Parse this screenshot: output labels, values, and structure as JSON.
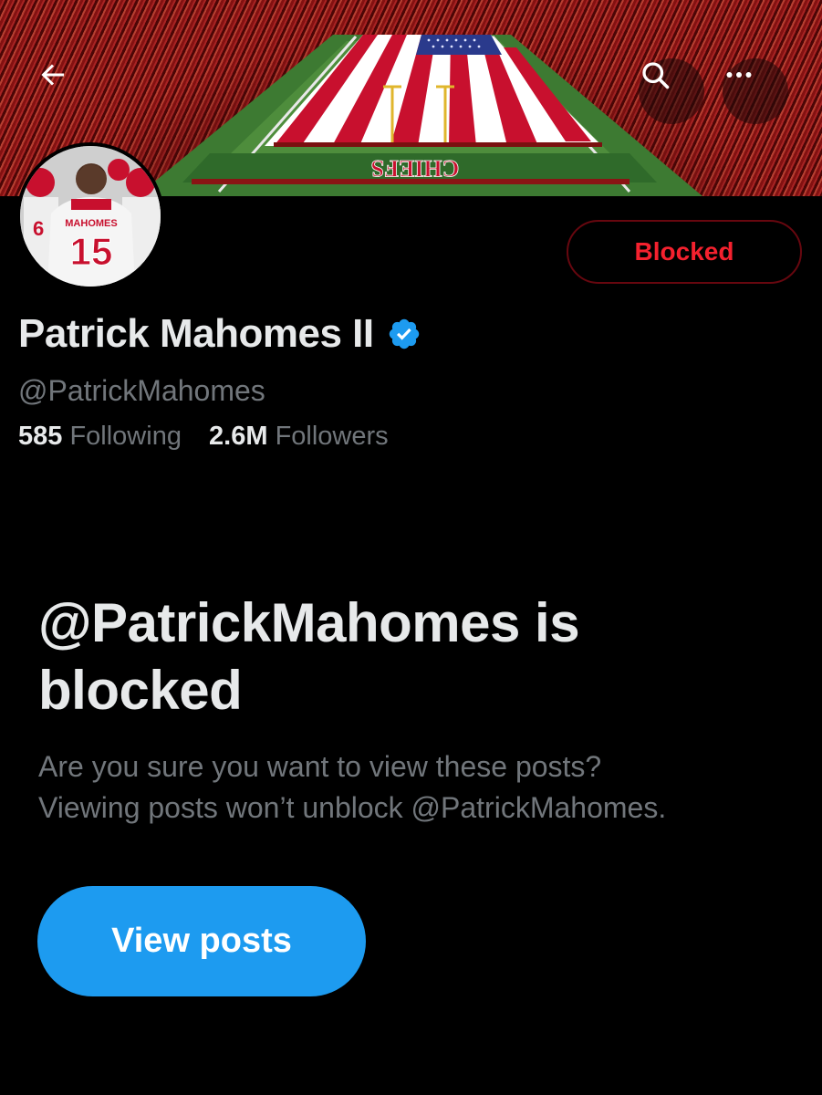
{
  "banner": {
    "back_icon": "arrow-left-icon",
    "search_icon": "search-icon",
    "more_icon": "more-horizontal-icon",
    "endzone_text": "CHIEFS",
    "endzone_text_2": "CHIEFS"
  },
  "avatar": {
    "jersey_name": "MAHOMES",
    "jersey_number": "15"
  },
  "profile": {
    "display_name": "Patrick Mahomes II",
    "handle": "@PatrickMahomes",
    "following_count": "585",
    "following_label": "Following",
    "followers_count": "2.6M",
    "followers_label": "Followers",
    "verified_icon": "verified-badge-icon"
  },
  "actions": {
    "blocked_label": "Blocked"
  },
  "notice": {
    "title": "@PatrickMahomes is blocked",
    "description_line1": "Are you sure you want to view these posts?",
    "description_line2": "Viewing posts won’t unblock @PatrickMahomes.",
    "view_posts_label": "View posts"
  },
  "colors": {
    "background": "#000000",
    "primary_text": "#e7e9ea",
    "secondary_text": "#71767b",
    "blocked_red": "#f4212e",
    "blocked_border": "#67070f",
    "accent_blue": "#1d9bf0"
  }
}
